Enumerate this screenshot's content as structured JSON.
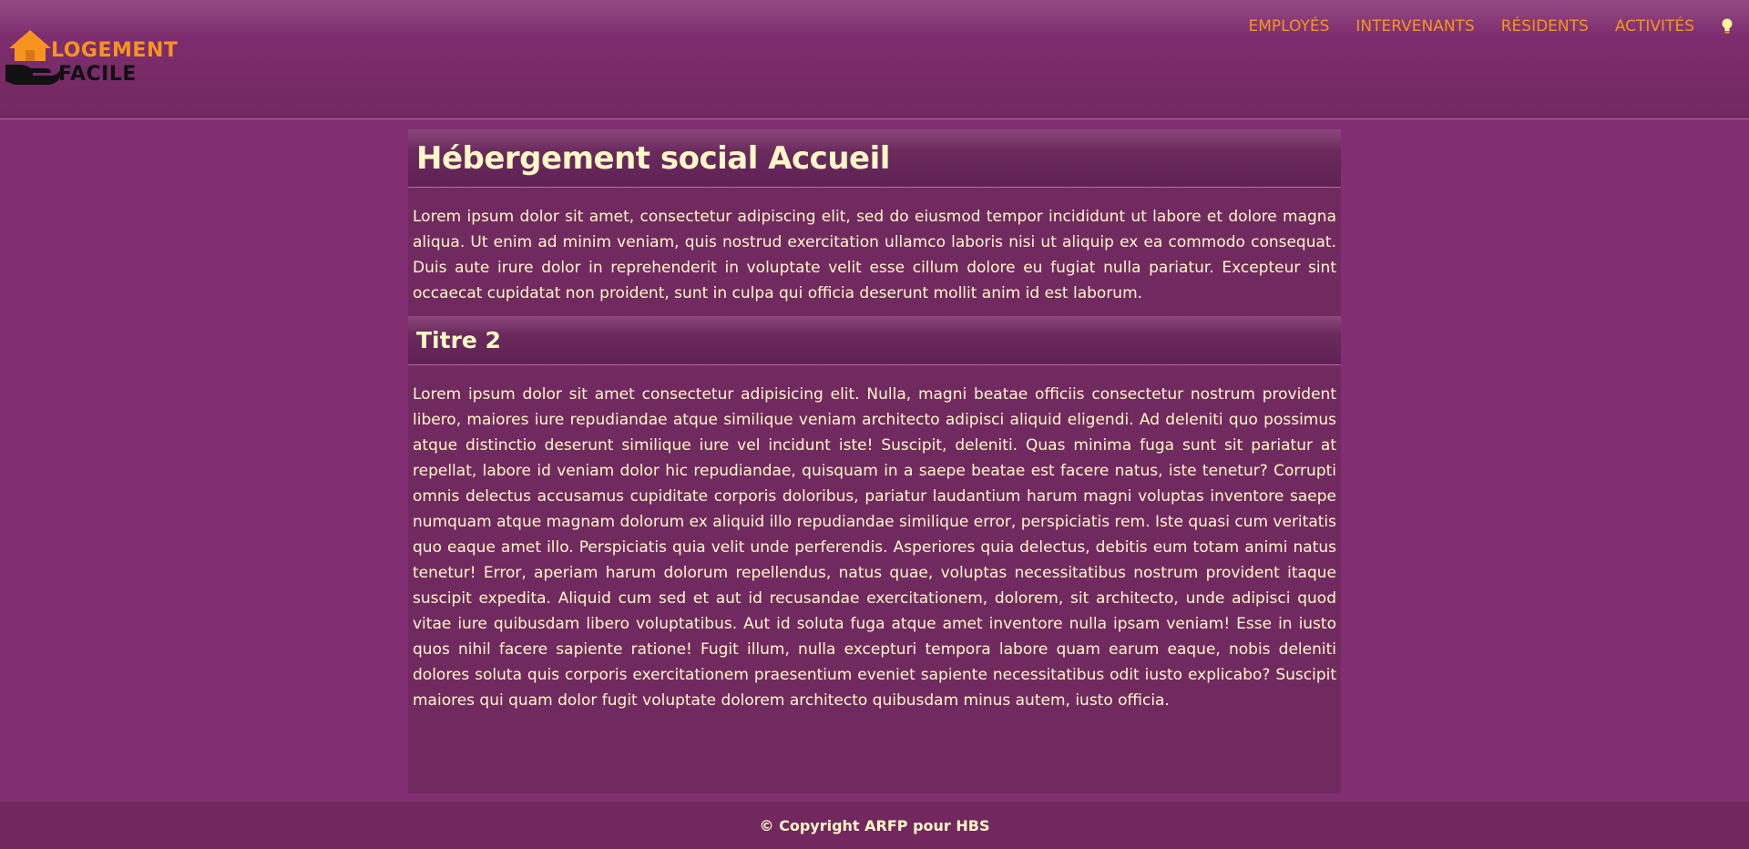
{
  "header": {
    "logo": {
      "line1": "LOGEMENT",
      "line2": "FACILE",
      "icon": "house-in-hand-icon"
    },
    "nav": [
      {
        "label": "EMPLOYÉS"
      },
      {
        "label": "INTERVENANTS"
      },
      {
        "label": "RÉSIDENTS"
      },
      {
        "label": "ACTIVITÉS"
      }
    ],
    "toggle_icon": "lightbulb-icon"
  },
  "main": {
    "title": "Hébergement social Accueil",
    "intro": "Lorem ipsum dolor sit amet, consectetur adipiscing elit, sed do eiusmod tempor incididunt ut labore et dolore magna aliqua. Ut enim ad minim veniam, quis nostrud exercitation ullamco laboris nisi ut aliquip ex ea commodo consequat. Duis aute irure dolor in reprehenderit in voluptate velit esse cillum dolore eu fugiat nulla pariatur. Excepteur sint occaecat cupidatat non proident, sunt in culpa qui officia deserunt mollit anim id est laborum.",
    "section_title": "Titre 2",
    "section_text": "Lorem ipsum dolor sit amet consectetur adipisicing elit. Nulla, magni beatae officiis consectetur nostrum provident libero, maiores iure repudiandae atque similique veniam architecto adipisci aliquid eligendi. Ad deleniti quo possimus atque distinctio deserunt similique iure vel incidunt iste! Suscipit, deleniti. Quas minima fuga sunt sit pariatur at repellat, labore id veniam dolor hic repudiandae, quisquam in a saepe beatae est facere natus, iste tenetur? Corrupti omnis delectus accusamus cupiditate corporis doloribus, pariatur laudantium harum magni voluptas inventore saepe numquam atque magnam dolorum ex aliquid illo repudiandae similique error, perspiciatis rem. Iste quasi cum veritatis quo eaque amet illo. Perspiciatis quia velit unde perferendis. Asperiores quia delectus, debitis eum totam animi natus tenetur! Error, aperiam harum dolorum repellendus, natus quae, voluptas necessitatibus nostrum provident itaque suscipit expedita. Aliquid cum sed et aut id recusandae exercitationem, dolorem, sit architecto, unde adipisci quod vitae iure quibusdam libero voluptatibus. Aut id soluta fuga atque amet inventore nulla ipsam veniam! Esse in iusto quos nihil facere sapiente ratione! Fugit illum, nulla excepturi tempora labore quam earum eaque, nobis deleniti dolores soluta quis corporis exercitationem praesentium eveniet sapiente necessitatibus odit iusto explicabo? Suscipit maiores qui quam dolor fugit voluptate dolorem architecto quibusdam minus autem, iusto officia."
  },
  "footer": {
    "copyright": "© Copyright ARFP pour HBS"
  },
  "colors": {
    "background": "#812e72",
    "header": "#72285f",
    "accent": "#f7941d",
    "text": "#fff8c6"
  }
}
